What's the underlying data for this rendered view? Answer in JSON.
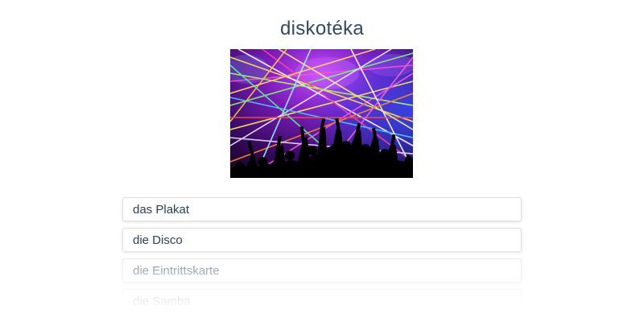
{
  "title": "diskotéka",
  "image": {
    "icon": "disco-lasers-crowd-image"
  },
  "options": [
    {
      "label": "das Plakat"
    },
    {
      "label": "die Disco"
    },
    {
      "label": "die Eintrittskarte"
    },
    {
      "label": "die Samba"
    }
  ],
  "colors": {
    "title_text": "#34495e",
    "option_text": "#2c3e50",
    "option_border": "#dcdfe4"
  }
}
